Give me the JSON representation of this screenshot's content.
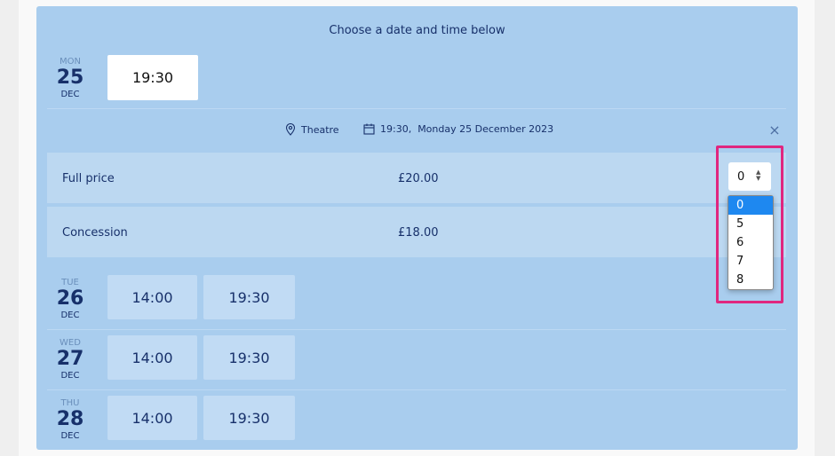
{
  "heading": "Choose a date and time below",
  "days": [
    {
      "dow": "MON",
      "day": "25",
      "month": "DEC",
      "slots": [
        "19:30"
      ]
    },
    {
      "dow": "TUE",
      "day": "26",
      "month": "DEC",
      "slots": [
        "14:00",
        "19:30"
      ]
    },
    {
      "dow": "WED",
      "day": "27",
      "month": "DEC",
      "slots": [
        "14:00",
        "19:30"
      ]
    },
    {
      "dow": "THU",
      "day": "28",
      "month": "DEC",
      "slots": [
        "14:00",
        "19:30"
      ]
    }
  ],
  "selection": {
    "venue": "Theatre",
    "datetime": "19:30,  Monday 25 December 2023",
    "close_icon": "close-icon"
  },
  "tickets": [
    {
      "name": "Full price",
      "price": "£20.00",
      "quantity": "0"
    },
    {
      "name": "Concession",
      "price": "£18.00"
    }
  ],
  "quantity_options": [
    "0",
    "5",
    "6",
    "7",
    "8"
  ],
  "colors": {
    "panel": "#a9cdee",
    "slot": "#c1dbf4",
    "selected_slot": "#ffffff",
    "highlight": "#e0267f",
    "option_selected": "#1e88f0"
  }
}
